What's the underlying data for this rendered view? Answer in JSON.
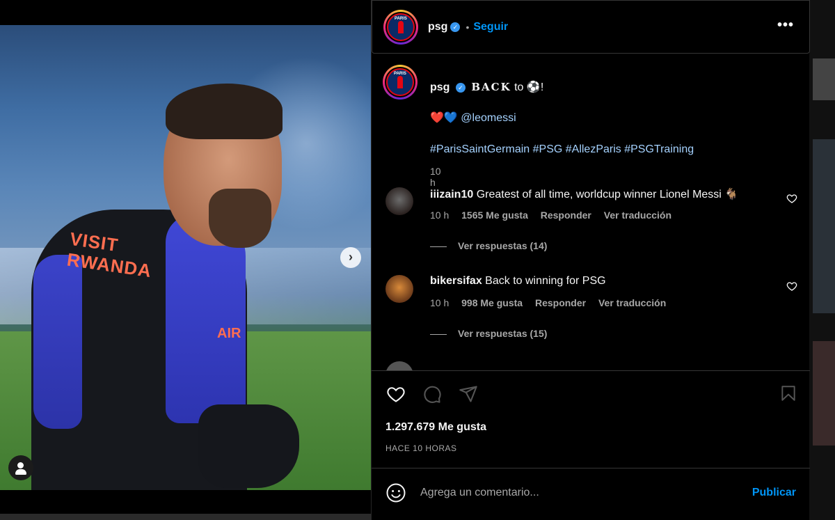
{
  "post": {
    "username": "psg",
    "follow_label": "Seguir",
    "more_label": "•••"
  },
  "caption": {
    "username": "psg",
    "title": "𝐁𝐀𝐂𝐊",
    "title_suffix": "to ⚽!",
    "hearts": "❤️💙",
    "mention": "@leomessi",
    "hashtags": "#ParisSaintGermain #PSG #AllezParis #PSGTraining",
    "time": "10 h"
  },
  "comments": [
    {
      "username": "iiizain10",
      "text": "Greatest of all time, worldcup winner Lionel Messi 🐐",
      "time": "10 h",
      "likes": "1565 Me gusta",
      "reply_label": "Responder",
      "translate_label": "Ver traducción",
      "replies_label": "Ver respuestas (14)"
    },
    {
      "username": "bikersifax",
      "text": "Back to winning for PSG",
      "time": "10 h",
      "likes": "998 Me gusta",
      "reply_label": "Responder",
      "translate_label": "Ver traducción",
      "replies_label": "Ver respuestas (15)"
    }
  ],
  "stats": {
    "likes": "1.297.679 Me gusta",
    "posted_ago": "HACE 10 HORAS"
  },
  "composer": {
    "placeholder": "Agrega un comentario...",
    "publish_label": "Publicar"
  },
  "photo": {
    "jersey_text_1": "VISIT",
    "jersey_text_2": "RWANDA",
    "jersey_logo": "AIR"
  },
  "icons": {
    "verified": "verified-icon",
    "like": "heart-icon",
    "comment": "comment-icon",
    "share": "send-icon",
    "save": "bookmark-icon",
    "emoji": "emoji-icon",
    "next": "chevron-right-icon",
    "tags": "user-tag-icon"
  },
  "colors": {
    "accent": "#0095f6",
    "background": "#000000",
    "muted": "#a8a8a8",
    "hashtag": "#a5d2ff"
  }
}
